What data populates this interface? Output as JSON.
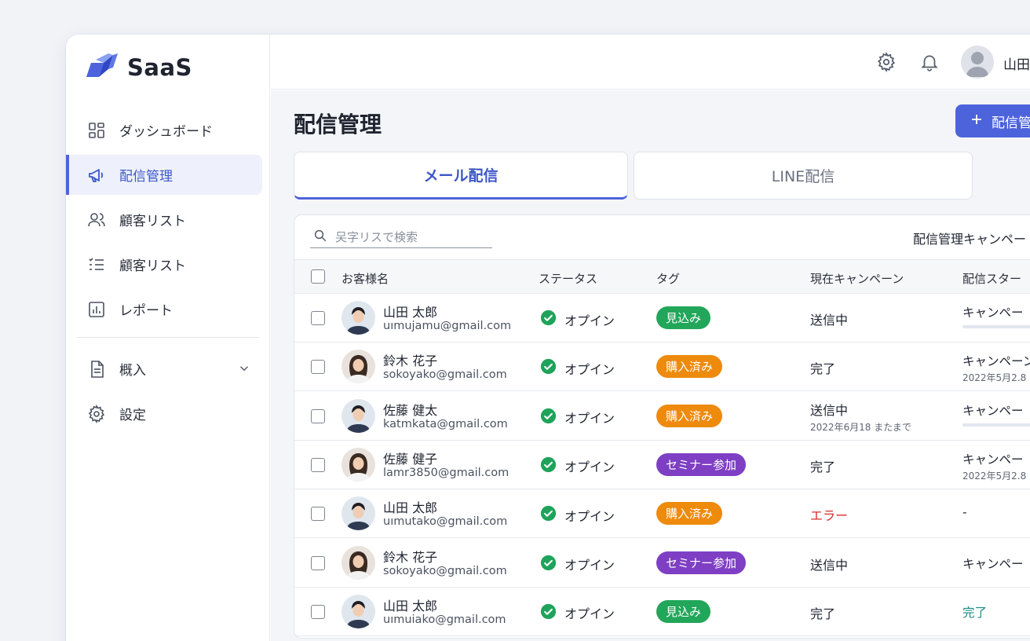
{
  "brand": {
    "name": "SaaS",
    "accent": "#4d63dc"
  },
  "sidebar": {
    "items": [
      {
        "label": "ダッシュボード",
        "icon": "dashboard-icon",
        "active": false
      },
      {
        "label": "配信管理",
        "icon": "megaphone-icon",
        "active": true
      },
      {
        "label": "顧客リスト",
        "icon": "users-icon",
        "active": false
      },
      {
        "label": "顧客リスト",
        "icon": "list-icon",
        "active": false
      },
      {
        "label": "レポート",
        "icon": "report-icon",
        "active": false
      }
    ],
    "bottom_items": [
      {
        "label": "概入",
        "icon": "document-icon",
        "expandable": true
      },
      {
        "label": "設定",
        "icon": "gear-icon",
        "expandable": false
      }
    ]
  },
  "topbar": {
    "user_name": "山田"
  },
  "page": {
    "title": "配信管理",
    "new_button_label": "配信管"
  },
  "tabs": [
    {
      "label": "メール配信",
      "active": true
    },
    {
      "label": "LINE配信",
      "active": false
    }
  ],
  "table_toolbar": {
    "search_placeholder": "㕦字リスで検索",
    "right_label": "配信管理キャンペー"
  },
  "table": {
    "columns": [
      "お客様名",
      "ステータス",
      "タグ",
      "現在キャンペーン",
      "配信スター"
    ],
    "rows": [
      {
        "name": "山田 太郎",
        "email": "uımujamu@gmail.com",
        "status": "オプイン",
        "tag": "見込み",
        "tag_color": "#22a65a",
        "campaign": "送信中",
        "campaign_sub": "",
        "campaign_color": "#1f2430",
        "delivery": "キャンペー",
        "delivery_sub": "",
        "progress": 0.6,
        "avatar_gender": "m"
      },
      {
        "name": "鈴木 花子",
        "email": "sokoyako@gmail.com",
        "status": "オプイン",
        "tag": "購入済み",
        "tag_color": "#ee8a0c",
        "campaign": "完了",
        "campaign_sub": "",
        "campaign_color": "#1f2430",
        "delivery": "キャンペーン",
        "delivery_sub": "2022年5月2.8",
        "progress": null,
        "avatar_gender": "f"
      },
      {
        "name": "佐藤 健太",
        "email": "katmkata@gmail.com",
        "status": "オプイン",
        "tag": "購入済み",
        "tag_color": "#ee8a0c",
        "campaign": "送信中",
        "campaign_sub": "2022年6月18 またまで",
        "campaign_color": "#1f2430",
        "delivery": "キャンペー",
        "delivery_sub": "",
        "progress": 0.58,
        "avatar_gender": "m"
      },
      {
        "name": "佐藤 健子",
        "email": "lamr3850@gmail.com",
        "status": "オプイン",
        "tag": "セミナー参加",
        "tag_color": "#7e3fc4",
        "campaign": "完了",
        "campaign_sub": "",
        "campaign_color": "#1f2430",
        "delivery": "キャンペー",
        "delivery_sub": "2022年5月2.8",
        "progress": null,
        "avatar_gender": "f"
      },
      {
        "name": "山田 太郎",
        "email": "uımutako@gmail.com",
        "status": "オプイン",
        "tag": "購入済み",
        "tag_color": "#ee8a0c",
        "campaign": "エラー",
        "campaign_sub": "",
        "campaign_color": "#d62c2c",
        "delivery": "-",
        "delivery_sub": "",
        "progress": null,
        "avatar_gender": "m"
      },
      {
        "name": "鈴木 花子",
        "email": "sokoyako@gmail.com",
        "status": "オプイン",
        "tag": "セミナー参加",
        "tag_color": "#7e3fc4",
        "campaign": "送信中",
        "campaign_sub": "",
        "campaign_color": "#1f2430",
        "delivery": "キャンペー",
        "delivery_sub": "",
        "progress": null,
        "avatar_gender": "f"
      },
      {
        "name": "山田 太郎",
        "email": "uımuiako@gmail.com",
        "status": "オプイン",
        "tag": "見込み",
        "tag_color": "#22a65a",
        "campaign": "完了",
        "campaign_sub": "",
        "campaign_color": "#1f2430",
        "delivery": "完了",
        "delivery_sub": "",
        "delivery_color": "#1b8a84",
        "progress": null,
        "avatar_gender": "m"
      }
    ]
  }
}
